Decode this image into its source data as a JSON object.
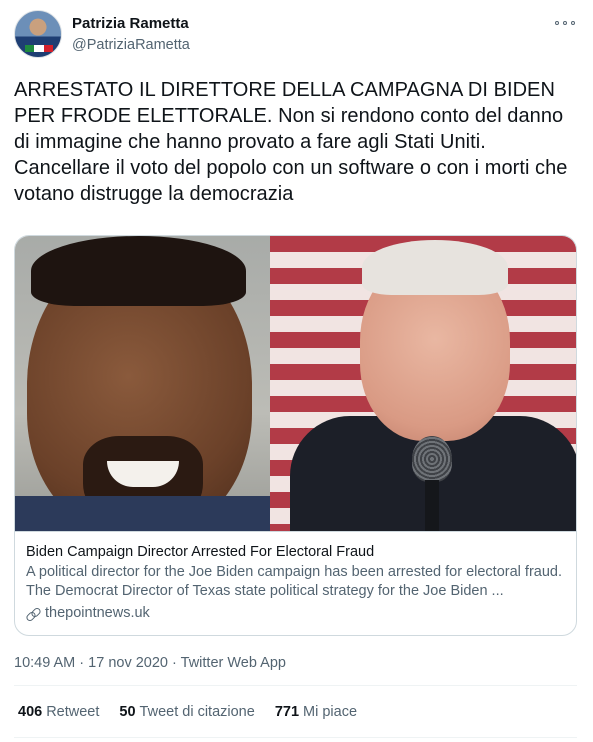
{
  "author": {
    "name": "Patrizia Rametta",
    "handle": "@PatriziaRametta"
  },
  "tweet": {
    "text": "ARRESTATO IL DIRETTORE DELLA CAMPAGNA DI BIDEN PER FRODE ELETTORALE. Non si rendono conto del danno di immagine che hanno provato a fare agli Stati Uniti. Cancellare il voto del popolo con un software o con i morti che votano distrugge la democrazia"
  },
  "card": {
    "title": "Biden Campaign Director Arrested For Electoral Fraud",
    "description": "A political director for the Joe Biden campaign has been arrested for electoral fraud. The Democrat Director of Texas state political strategy for the Joe Biden ...",
    "domain": "thepointnews.uk"
  },
  "meta": {
    "time": "10:49 AM",
    "separator": "·",
    "date": "17 nov 2020",
    "source": "Twitter Web App"
  },
  "stats": {
    "retweets_count": "406",
    "retweets_label": "Retweet",
    "quotes_count": "50",
    "quotes_label": "Tweet di citazione",
    "likes_count": "771",
    "likes_label": "Mi piace"
  },
  "colors": {
    "text_primary": "#0f1419",
    "text_secondary": "#536471",
    "border": "#cfd9de"
  },
  "icons": {
    "more": "more-horizontal-icon",
    "link": "link-icon"
  }
}
